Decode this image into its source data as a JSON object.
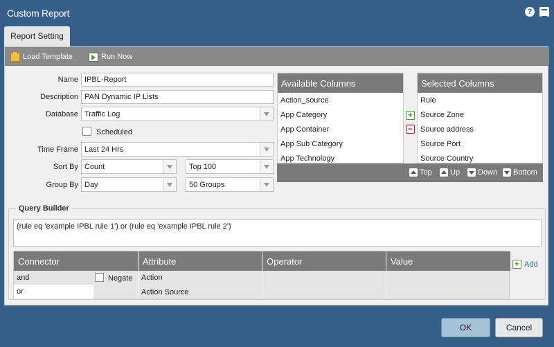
{
  "window": {
    "title": "Custom Report"
  },
  "tabs": [
    {
      "label": "Report Setting"
    }
  ],
  "toolbar": {
    "load_template": "Load Template",
    "run_now": "Run Now"
  },
  "form": {
    "name_label": "Name",
    "name_value": "IPBL-Report",
    "description_label": "Description",
    "description_value": "PAN Dynamic IP Lists",
    "database_label": "Database",
    "database_value": "Traffic Log",
    "scheduled_label": "Scheduled",
    "scheduled_checked": false,
    "timeframe_label": "Time Frame",
    "timeframe_value": "Last 24 Hrs",
    "sortby_label": "Sort By",
    "sortby_value": "Count",
    "sortby_top_value": "Top 100",
    "groupby_label": "Group By",
    "groupby_value": "Day",
    "groupby_groups_value": "50 Groups"
  },
  "available_columns": {
    "header": "Available Columns",
    "items": [
      "Action_source",
      "App Category",
      "App Container",
      "App Sub Category",
      "App Technology"
    ]
  },
  "selected_columns": {
    "header": "Selected Columns",
    "items": [
      "Rule",
      "Source Zone",
      "Source address",
      "Source Port",
      "Source Country"
    ]
  },
  "move_controls": {
    "top": "Top",
    "up": "Up",
    "down": "Down",
    "bottom": "Bottom"
  },
  "query_builder": {
    "legend": "Query Builder",
    "query": "(rule eq 'example IPBL rule 1') or (rule eq 'example IPBL rule 2')",
    "columns": [
      "Connector",
      "Attribute",
      "Operator",
      "Value"
    ],
    "connector_options": [
      "and",
      "or"
    ],
    "negate_label": "Negate",
    "attribute_options": [
      "Action",
      "Action Source"
    ],
    "add_label": "Add"
  },
  "buttons": {
    "ok": "OK",
    "cancel": "Cancel"
  },
  "colors": {
    "window_bg": "#35608a",
    "header_gray": "#7a7a7a",
    "ok_button": "#a7c2d8"
  }
}
